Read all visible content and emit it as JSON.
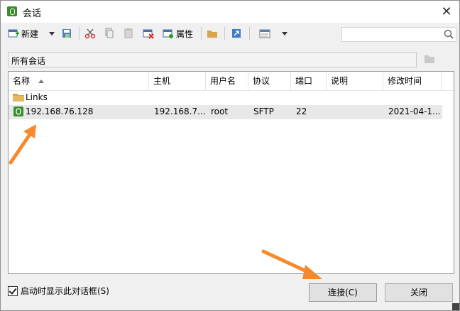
{
  "window": {
    "title": "会话",
    "close_glyph": "✕"
  },
  "toolbar": {
    "new_label": "新建",
    "properties_label": "属性"
  },
  "path_bar": {
    "text": "所有会话"
  },
  "list": {
    "columns": [
      "名称",
      "主机",
      "用户名",
      "协议",
      "端口",
      "说明",
      "修改时间"
    ],
    "rows": [
      {
        "type": "folder",
        "name": "Links",
        "host": "",
        "user": "",
        "protocol": "",
        "port": "",
        "description": "",
        "modified": ""
      },
      {
        "type": "session",
        "name": "192.168.76.128",
        "host": "192.168.7...",
        "user": "root",
        "protocol": "SFTP",
        "port": "22",
        "description": "",
        "modified": "2021-04-1..."
      }
    ]
  },
  "footer": {
    "show_on_startup_label": "启动时显示此对话框(S)",
    "show_on_startup_checked": true,
    "connect_label": "连接(C)",
    "close_label": "关闭"
  },
  "colors": {
    "accent_arrow": "#f7892b",
    "session_icon": "#3a8d2f",
    "folder": "#d9a44a"
  }
}
